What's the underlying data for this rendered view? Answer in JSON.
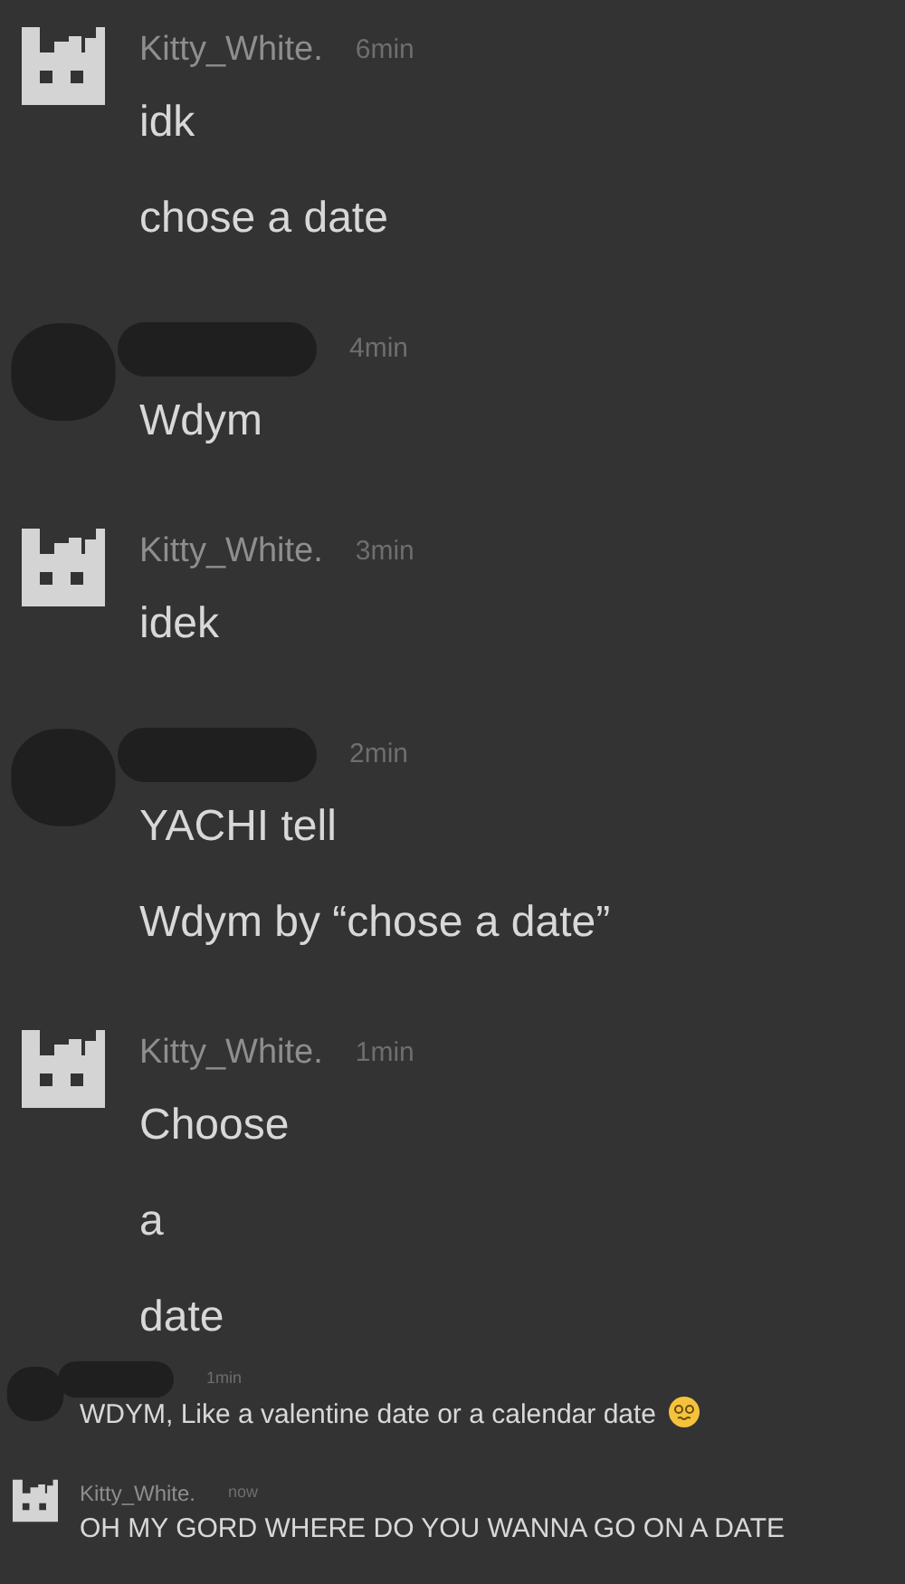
{
  "messages": [
    {
      "kind": "large",
      "redacted": false,
      "author": "Kitty_White.",
      "time": "6min",
      "lines": [
        "idk",
        "chose a date"
      ]
    },
    {
      "kind": "large",
      "redacted": true,
      "time": "4min",
      "lines": [
        "Wdym"
      ]
    },
    {
      "kind": "large",
      "redacted": false,
      "author": "Kitty_White.",
      "time": "3min",
      "lines": [
        "idek"
      ]
    },
    {
      "kind": "large",
      "redacted": true,
      "time": "2min",
      "lines": [
        "YACHI tell",
        "Wdym by “chose a date”"
      ]
    },
    {
      "kind": "large",
      "redacted": false,
      "author": "Kitty_White.",
      "time": "1min",
      "lines": [
        "Choose",
        "a",
        "date"
      ]
    },
    {
      "kind": "small",
      "redacted": true,
      "time": "1min",
      "lines": [
        "WDYM, Like a valentine date or a calendar date"
      ],
      "emoji": true
    },
    {
      "kind": "small",
      "redacted": false,
      "author": "Kitty_White.",
      "time": "now",
      "lines": [
        "OH MY GORD WHERE DO YOU WANNA GO ON A DATE"
      ]
    }
  ]
}
